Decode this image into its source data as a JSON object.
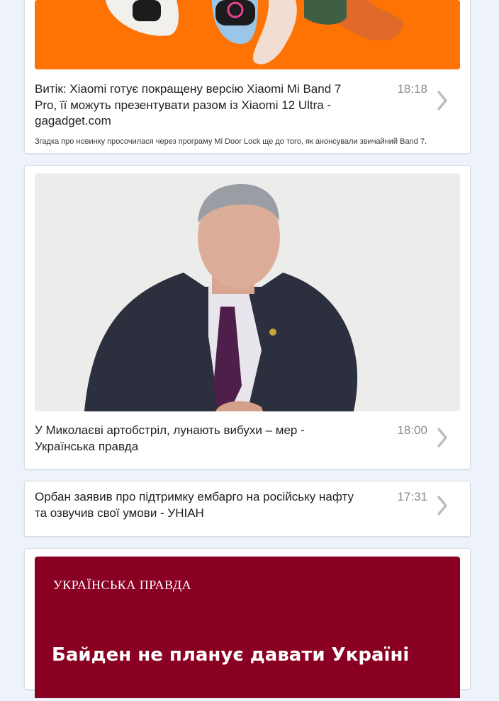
{
  "feed": {
    "items": [
      {
        "title": "Витік: Xiaomi готує покращену версію Xiaomi Mi Band 7 Pro, її можуть презентувати разом із Xiaomi 12 Ultra - gagadget.com",
        "time": "18:18",
        "description": "Згадка про новинку просочилася через програму Mi Door Lock ще до того, як анонсували звичайний Band 7.",
        "image": "smartwatch-bands-photo",
        "image_bg": "#fe7304"
      },
      {
        "title": "У Миколаєві артобстріл, лунають вибухи – мер - Українська правда",
        "time": "18:00",
        "image": "man-in-suit-photo"
      },
      {
        "title": "Орбан заявив про підтримку ембарго на російську нафту та озвучив свої умови - УНІАН",
        "time": "17:31"
      },
      {
        "image_logo": "УКРАЇНСЬКА ПРАВДА",
        "image_headline": "Байден не планує давати Україні",
        "image_bg": "#8a0022"
      }
    ]
  },
  "icons": {
    "chevron": "chevron-right-icon"
  }
}
